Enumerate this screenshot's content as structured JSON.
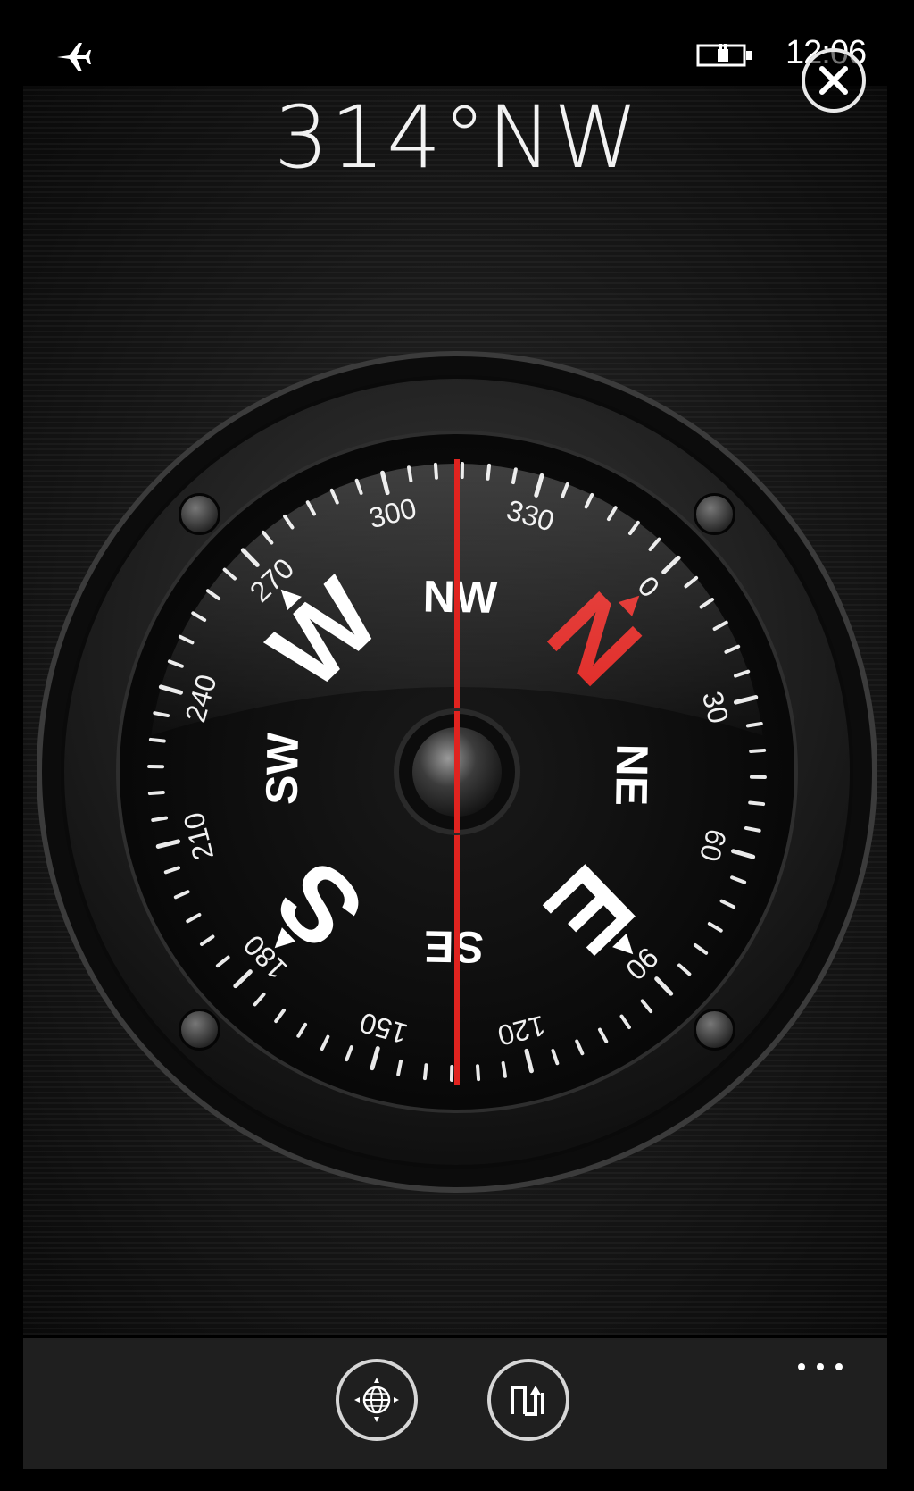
{
  "status_bar": {
    "airplane_icon": "airplane-icon",
    "battery_icon": "battery-charging-icon",
    "time": "12:06"
  },
  "close_icon": "close-icon",
  "heading": {
    "degrees": "314°",
    "direction": "NW"
  },
  "compass": {
    "heading_deg": 314,
    "dial_numbers": [
      "0",
      "30",
      "60",
      "90",
      "120",
      "150",
      "180",
      "210",
      "240",
      "270",
      "300",
      "330"
    ],
    "cardinals": {
      "n": "N",
      "e": "E",
      "s": "S",
      "w": "W"
    },
    "intercardinals": {
      "ne": "NE",
      "se": "SE",
      "sw": "SW",
      "nw": "NW"
    },
    "needle_color": "#e0231f",
    "north_color": "#e0231f"
  },
  "appbar": {
    "map_icon": "globe-map-icon",
    "mode_icon": "calibrate-toggle-icon",
    "more_icon": "more-ellipsis-icon"
  }
}
